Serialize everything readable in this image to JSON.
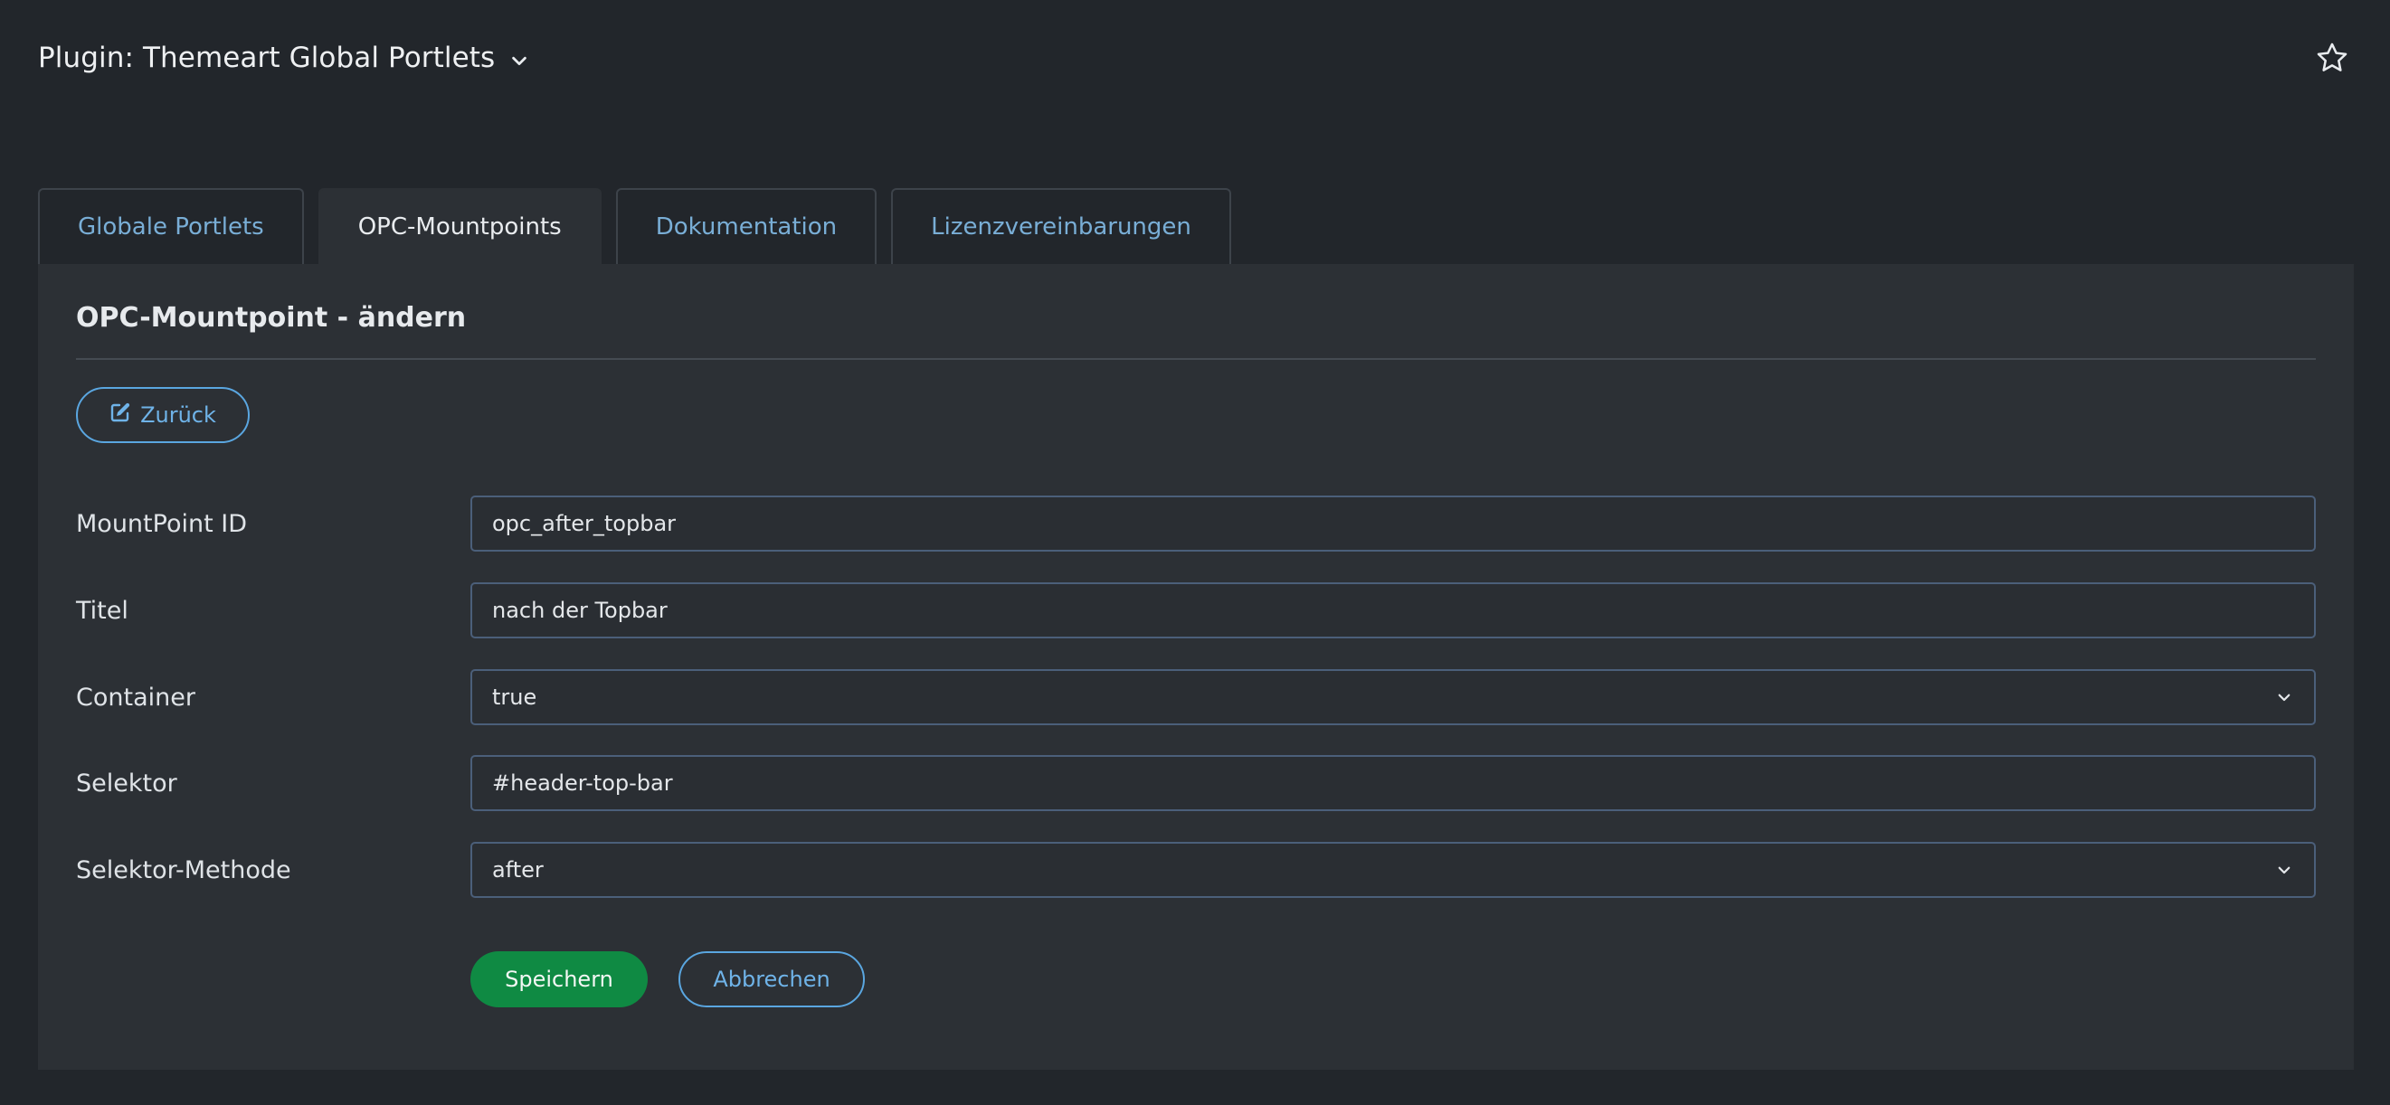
{
  "header": {
    "title": "Plugin: Themeart Global Portlets",
    "dropdown_icon": "chevron-down-icon",
    "favorite_icon": "star-icon"
  },
  "tabs": [
    {
      "label": "Globale Portlets",
      "active": false
    },
    {
      "label": "OPC-Mountpoints",
      "active": true
    },
    {
      "label": "Dokumentation",
      "active": false
    },
    {
      "label": "Lizenzvereinbarungen",
      "active": false
    }
  ],
  "panel": {
    "title": "OPC-Mountpoint - ändern",
    "back_button": "Zurück",
    "back_icon": "edit-icon"
  },
  "form": {
    "mountpoint_id": {
      "label": "MountPoint ID",
      "value": "opc_after_topbar"
    },
    "titel": {
      "label": "Titel",
      "value": "nach der Topbar"
    },
    "container": {
      "label": "Container",
      "value": "true"
    },
    "selektor": {
      "label": "Selektor",
      "value": "#header-top-bar"
    },
    "selektor_methode": {
      "label": "Selektor-Methode",
      "value": "after"
    }
  },
  "actions": {
    "save": "Speichern",
    "cancel": "Abbrechen"
  },
  "colors": {
    "accent": "#5aa6e0",
    "success": "#0f8a43",
    "background": "#22262b",
    "panel": "#2c3035"
  }
}
